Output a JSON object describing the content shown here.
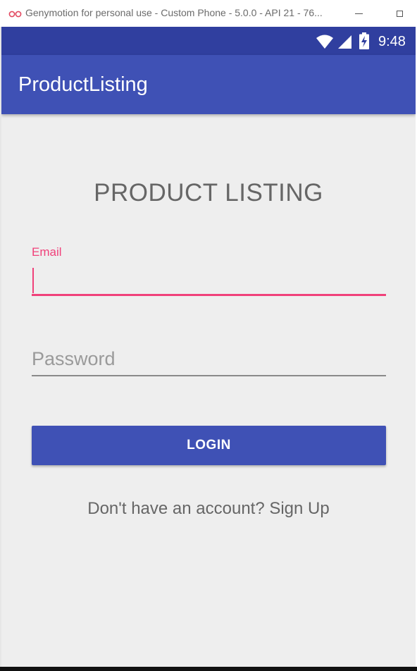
{
  "host_window": {
    "title": "Genymotion for personal use - Custom Phone - 5.0.0 - API 21 - 76..."
  },
  "status_bar": {
    "time": "9:48",
    "icons": [
      "wifi-icon",
      "signal-icon",
      "battery-charging-icon"
    ]
  },
  "app_bar": {
    "title": "ProductListing"
  },
  "login_form": {
    "heading": "PRODUCT LISTING",
    "email_label": "Email",
    "email_value": "",
    "password_placeholder": "Password",
    "login_button": "LOGIN",
    "signup_text": "Don't have an account? Sign Up"
  },
  "colors": {
    "status_bar": "#303f9f",
    "app_bar": "#3f51b5",
    "accent": "#f0417a",
    "background": "#eeeeee",
    "button": "#3f51b5"
  }
}
